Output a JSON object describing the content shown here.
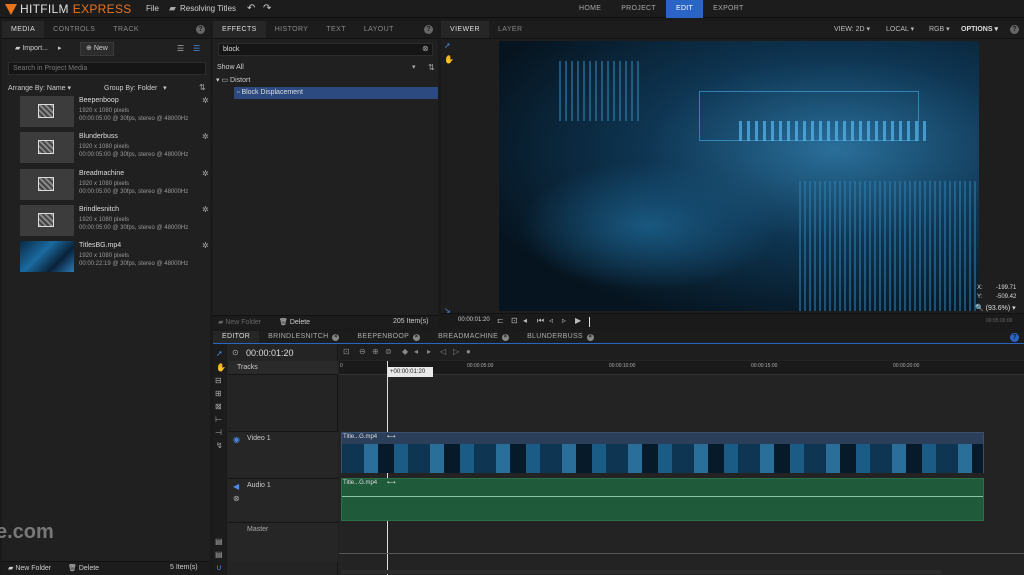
{
  "app": {
    "brand_a": "HITFILM",
    "brand_b": "EXPRESS",
    "file_menu": "File",
    "project_name": "Resolving Titles"
  },
  "topnav": [
    "HOME",
    "PROJECT",
    "EDIT",
    "EXPORT"
  ],
  "media_panel": {
    "tabs": [
      "MEDIA",
      "CONTROLS",
      "TRACK"
    ],
    "import_label": "Import...",
    "new_label": "New",
    "search_placeholder": "Search in Project Media",
    "arrange_label": "Arrange By: Name",
    "group_label": "Group By: Folder",
    "items": [
      {
        "name": "Beepenboop",
        "res": "1920 x 1080 pixels",
        "info": "00:00:05:00 @ 30fps, stereo @ 48000Hz"
      },
      {
        "name": "Blunderbuss",
        "res": "1920 x 1080 pixels",
        "info": "00:00:05:00 @ 30fps, stereo @ 48000Hz"
      },
      {
        "name": "Breadmachine",
        "res": "1920 x 1080 pixels",
        "info": "00:00:05:00 @ 30fps, stereo @ 48000Hz"
      },
      {
        "name": "Brindlesnitch",
        "res": "1920 x 1080 pixels",
        "info": "00:00:05:00 @ 30fps, stereo @ 48000Hz"
      },
      {
        "name": "TitlesBG.mp4",
        "res": "1920 x 1080 pixels",
        "info": "00:00:22:19 @ 30fps, stereo @ 48000Hz"
      }
    ],
    "new_folder": "New Folder",
    "delete": "Delete",
    "count": "5 Item(s)"
  },
  "effects_panel": {
    "tabs": [
      "EFFECTS",
      "HISTORY",
      "TEXT",
      "LAYOUT"
    ],
    "search_value": "block",
    "filter": "Show All",
    "folder": "Distort",
    "effect": "Block Displacement",
    "new_folder": "New Folder",
    "delete": "Delete",
    "count": "205 Item(s)"
  },
  "viewer": {
    "tabs": [
      "VIEWER",
      "LAYER"
    ],
    "view": "VIEW: 2D",
    "space": "LOCAL",
    "channel": "RGB",
    "options": "OPTIONS",
    "x_label": "X:",
    "x_value": "-199.71",
    "y_label": "Y:",
    "y_value": "-509.42",
    "zoom": "(93.6%)",
    "timecode": "00:00:01:20",
    "end_time": "00:05:00:00"
  },
  "editor": {
    "tabs": [
      "EDITOR",
      "BRINDLESNITCH",
      "BEEPENBOOP",
      "BREADMACHINE",
      "BLUNDERBUSS"
    ],
    "timecode": "00:00:01:20",
    "tracks_label": "Tracks",
    "playhead_tip": "+00:00:01:20",
    "ruler": [
      "0",
      "00:00:05:00",
      "00:00:10:00",
      "00:00:15:00",
      "00:00:20:00"
    ],
    "video_track": "Video 1",
    "audio_track": "Audio 1",
    "master_track": "Master",
    "video_clip": "Title...G.mp4",
    "audio_clip": "Title...G.mp4"
  },
  "watermark": "e.com",
  "colors": {
    "accent": "#2a64c4",
    "brand": "#e8741e",
    "audio_clip": "#1f5a3a",
    "video_clip": "#2c3f5a"
  }
}
